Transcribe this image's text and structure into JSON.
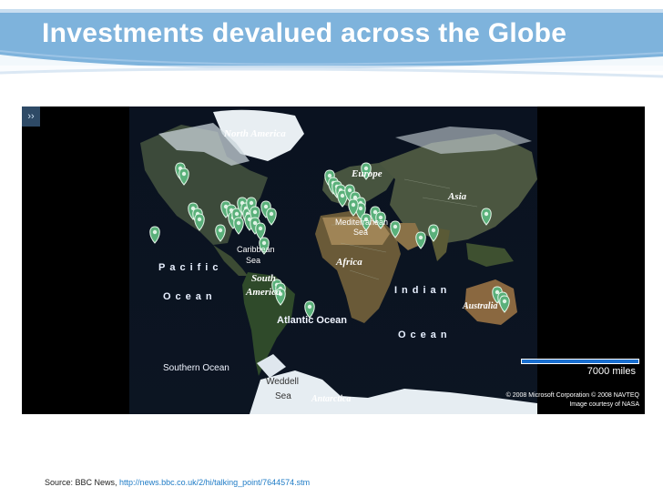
{
  "slide": {
    "title": "Investments devalued across the Globe",
    "source_label": "Source: BBC News,",
    "source_url": "http://news.bbc.co.uk/2/hi/talking_point/7644574.stm"
  },
  "map": {
    "expand_label": "››",
    "labels": {
      "north_america": "North America",
      "europe": "Europe",
      "asia": "Asia",
      "mediterranean": "Mediterranean",
      "sea": "Sea",
      "caribbean": "Caribbean",
      "caribbean_sea": "Sea",
      "south": "South",
      "america": "America",
      "africa": "Africa",
      "atlantic_ocean": "Atlantic Ocean",
      "pacific": "Pacific",
      "pacific_ocean": "Ocean",
      "indian": "Indian",
      "indian_ocean": "Ocean",
      "australia": "Australia",
      "southern_ocean": "Southern Ocean",
      "weddell": "Weddell",
      "weddell_sea": "Sea",
      "antarctica": "Antarctica"
    },
    "scale_label": "7000 miles",
    "copyright_line1": "© 2008 Microsoft Corporation   © 2008 NAVTEQ",
    "copyright_line2": "Image courtesy of NASA",
    "marker_color": "#5ab07a",
    "marker_count": 48
  }
}
